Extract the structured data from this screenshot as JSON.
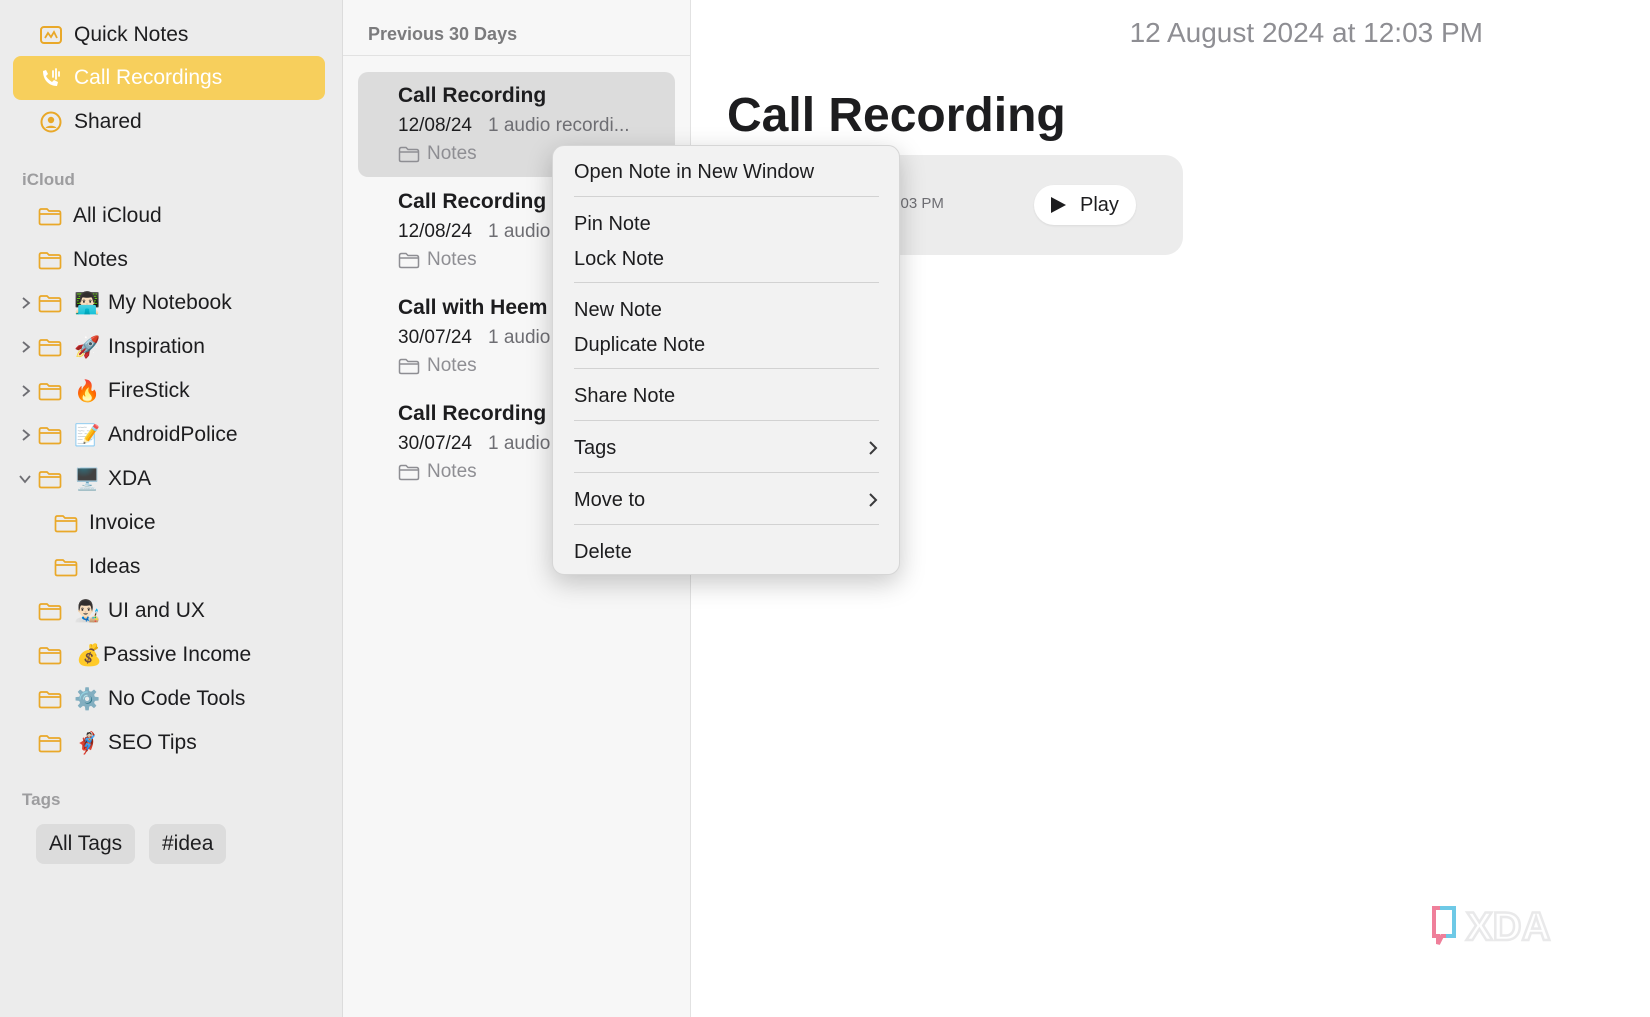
{
  "sidebar": {
    "top_items": [
      {
        "label": "Quick Notes",
        "icon": "quick-notes-icon"
      },
      {
        "label": "Call Recordings",
        "icon": "phone-waveform-icon",
        "selected": true
      },
      {
        "label": "Shared",
        "icon": "person-circle-icon"
      }
    ],
    "icloud_title": "iCloud",
    "folders": [
      {
        "label": "All iCloud",
        "emoji": ""
      },
      {
        "label": "Notes",
        "emoji": ""
      },
      {
        "label": "My Notebook",
        "emoji": "👨🏻‍💻",
        "expandable": true
      },
      {
        "label": "Inspiration",
        "emoji": "🚀",
        "expandable": true
      },
      {
        "label": "FireStick",
        "emoji": "🔥",
        "expandable": true
      },
      {
        "label": "AndroidPolice",
        "emoji": "📝",
        "expandable": true
      },
      {
        "label": "XDA",
        "emoji": "🖥️",
        "expandable": true,
        "expanded": true
      },
      {
        "label": "Invoice",
        "emoji": ""
      },
      {
        "label": "Ideas",
        "emoji": ""
      },
      {
        "label": "UI and UX",
        "emoji": "👨🏻‍🎨"
      },
      {
        "label": "Passive Income",
        "emoji": "💰"
      },
      {
        "label": "No Code Tools",
        "emoji": "⚙️"
      },
      {
        "label": "SEO Tips",
        "emoji": "🦸🏻"
      }
    ],
    "tags_title": "Tags",
    "tags": [
      "All Tags",
      "#idea"
    ]
  },
  "list": {
    "header": "Previous 30 Days",
    "notes": [
      {
        "title": "Call Recording",
        "date": "12/08/24",
        "preview": "1 audio recordi...",
        "folder": "Notes",
        "selected": true
      },
      {
        "title": "Call Recording",
        "date": "12/08/24",
        "preview": "1 audio",
        "folder": "Notes"
      },
      {
        "title": "Call with Heem",
        "date": "30/07/24",
        "preview": "1 audio",
        "folder": "Notes"
      },
      {
        "title": "Call Recording",
        "date": "30/07/24",
        "preview": "1 audio",
        "folder": "Notes"
      }
    ]
  },
  "editor": {
    "timestamp": "12 August 2024 at 12:03 PM",
    "title": "Call Recording",
    "audio_time": "2:03 PM",
    "play_label": "Play"
  },
  "context_menu": {
    "items": [
      "Open Note in New Window",
      "Pin Note",
      "Lock Note",
      "New Note",
      "Duplicate Note",
      "Share Note",
      "Tags",
      "Move to",
      "Delete"
    ]
  },
  "watermark": "XDA",
  "colors": {
    "accent": "#f7cf5c",
    "folder_icon": "#e9a829",
    "sidebar_bg": "#ececec",
    "menu_bg": "#f2f2f2"
  }
}
